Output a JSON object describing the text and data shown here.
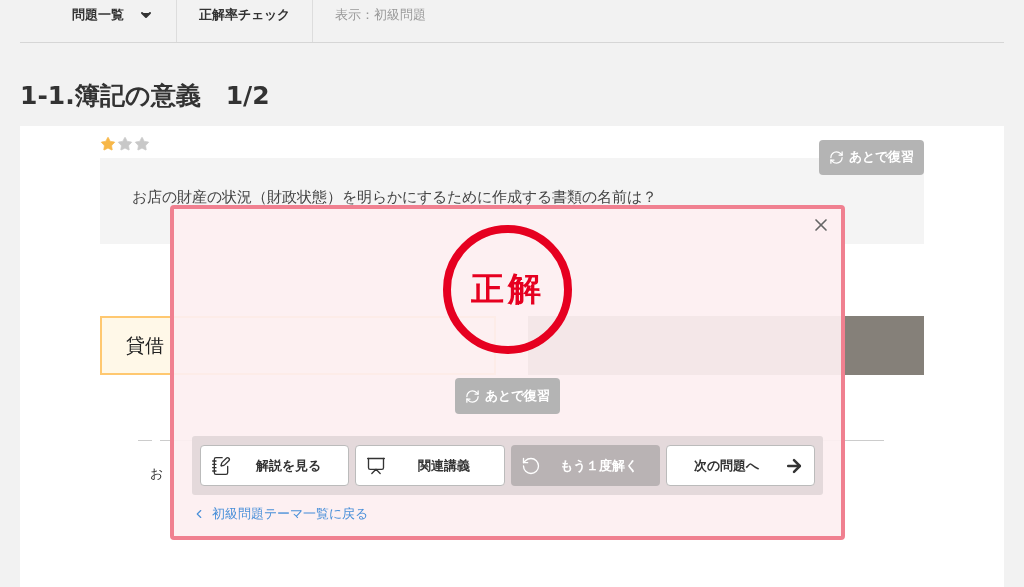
{
  "nav": [
    {
      "label": "問題一覧",
      "kind": "dropdown"
    },
    {
      "label": "正解率チェック",
      "kind": "link"
    },
    {
      "label": "表示：初級問題",
      "kind": "info"
    }
  ],
  "title": "1-1.簿記の意義　1/2",
  "question": {
    "stars": 1,
    "text": "お店の財産の状況（財政状態）を明らかにするために作成する書類の名前は？",
    "review_button": "あとで復習"
  },
  "choices": [
    {
      "label": "貸借",
      "selected": true
    },
    {
      "selected": false
    }
  ],
  "explanation": {
    "text": "お"
  },
  "result_modal": {
    "verdict": "正解",
    "review_button": "あとで復習",
    "actions": [
      {
        "label": "解説を見る",
        "kind": "explanation",
        "disabled": false
      },
      {
        "label": "関連講義",
        "kind": "lecture",
        "disabled": false
      },
      {
        "label": "もう１度解く",
        "kind": "retry",
        "disabled": true
      },
      {
        "label": "次の問題へ",
        "kind": "next",
        "disabled": false
      }
    ],
    "back_link": "初級問題テーマ一覧に戻る"
  }
}
